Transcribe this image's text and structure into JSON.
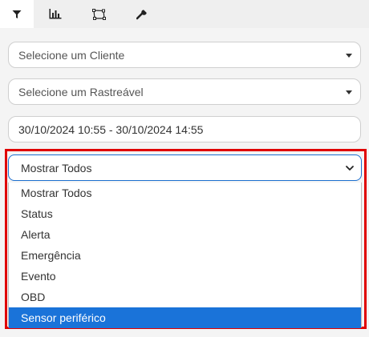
{
  "tabs": [
    {
      "icon": "filter-icon",
      "active": true
    },
    {
      "icon": "bar-chart-icon",
      "active": false
    },
    {
      "icon": "polygon-icon",
      "active": false
    },
    {
      "icon": "wrench-icon",
      "active": false
    }
  ],
  "client_select": {
    "placeholder": "Selecione um Cliente"
  },
  "tracker_select": {
    "placeholder": "Selecione um Rastreável"
  },
  "date_range": {
    "value": "30/10/2024 10:55 - 30/10/2024 14:55"
  },
  "event_filter": {
    "selected": "Mostrar Todos",
    "options": [
      "Mostrar Todos",
      "Status",
      "Alerta",
      "Emergência",
      "Evento",
      "OBD",
      "Sensor periférico"
    ],
    "highlighted_option": "Sensor periférico"
  },
  "colors": {
    "highlight_border": "#e00000",
    "option_selected_bg": "#1a73d9",
    "select_focus_border": "#1c6fcf"
  }
}
